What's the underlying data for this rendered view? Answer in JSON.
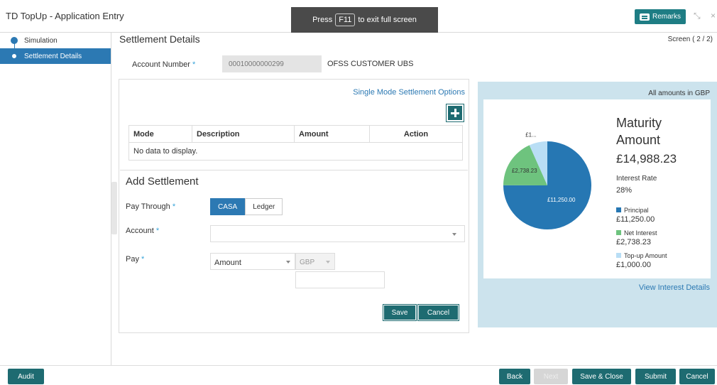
{
  "header": {
    "app_title": "TD TopUp - Application Entry",
    "fullscreen_press": "Press",
    "fullscreen_key": "F11",
    "fullscreen_suffix": "to exit full screen",
    "remarks_label": "Remarks"
  },
  "sidebar": {
    "items": [
      {
        "label": "Simulation",
        "state": "complete"
      },
      {
        "label": "Settlement Details",
        "state": "active"
      }
    ]
  },
  "page": {
    "section_title": "Settlement Details",
    "screen_label": "Screen ( 2 / 2)"
  },
  "account": {
    "label": "Account Number",
    "required_mark": "*",
    "value": "00010000000299",
    "name": "OFSS CUSTOMER UBS"
  },
  "settlement_table": {
    "link": "Single Mode Settlement Options",
    "columns": [
      "Mode",
      "Description",
      "Amount",
      "Action"
    ],
    "empty_text": "No data to display."
  },
  "add_settlement": {
    "title": "Add Settlement",
    "pay_through_label": "Pay Through",
    "pay_through_options": [
      "CASA",
      "Ledger"
    ],
    "pay_through_selected": "CASA",
    "account_label": "Account",
    "account_value": "",
    "pay_label": "Pay",
    "pay_type_value": "Amount",
    "currency_value": "GBP",
    "amount_value": "",
    "save_label": "Save",
    "cancel_label": "Cancel"
  },
  "summary": {
    "currency_note": "All amounts in GBP",
    "maturity_title_line1": "Maturity",
    "maturity_title_line2": "Amount",
    "maturity_amount": "£14,988.23",
    "interest_rate_label": "Interest Rate",
    "interest_rate_value": "28%",
    "view_interest_link": "View Interest Details"
  },
  "chart_data": {
    "type": "pie",
    "series": [
      {
        "name": "Principal",
        "value": 11250.0,
        "display": "£11,250.00",
        "slice_label": "£11,250.00",
        "color": "#2677b3"
      },
      {
        "name": "Net Interest",
        "value": 2738.23,
        "display": "£2,738.23",
        "slice_label": "£2,738.23",
        "color": "#6ec37e"
      },
      {
        "name": "Top-up Amount",
        "value": 1000.0,
        "display": "£1,000.00",
        "slice_label": "£1...",
        "color": "#b9def5"
      }
    ],
    "total": 14988.23,
    "legend_position": "right"
  },
  "footer": {
    "audit_label": "Audit",
    "back_label": "Back",
    "next_label": "Next",
    "save_close_label": "Save & Close",
    "submit_label": "Submit",
    "cancel_label": "Cancel"
  },
  "colors": {
    "teal": "#1e6b71",
    "blue": "#2c79b3",
    "summary_bg": "#cce3ed"
  }
}
